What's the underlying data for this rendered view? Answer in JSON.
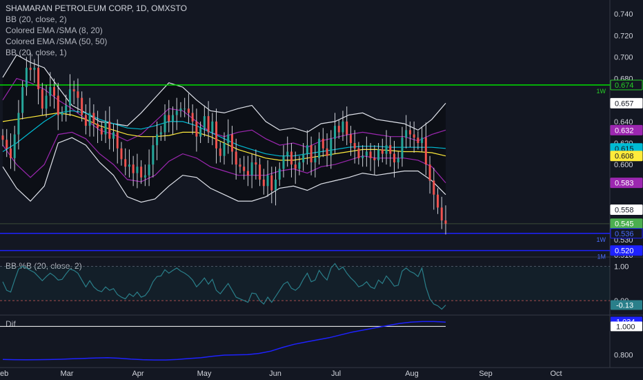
{
  "colors": {
    "background": "#131722",
    "up": "#26a69a",
    "down": "#ef5350",
    "bb_main": "#e0e3eb",
    "bb_inner": "#9c27b0",
    "ema_fast": "#00bcd4",
    "sma_slow": "#ffeb3b",
    "pct_line": "#2a7f8a",
    "dif_line": "#1e22ff",
    "green_line": "#00e000",
    "blue_line": "#1e22ff"
  },
  "legend": {
    "main_title": "SHAMARAN PETROLEUM CORP, 1D, OMXSTO",
    "bb_outer": "BB (20, close, 2)",
    "ema_sma_fast": "Colored EMA /SMA (8, 20)",
    "ema_sma_slow": "Colored EMA /SMA (50, 50)",
    "bb_inner": "BB (20, close, 1)",
    "pct_b": "BB %B (20, close, 2)",
    "dif": "Dif"
  },
  "chart_data": [
    {
      "type": "candlestick",
      "title": "SHAMARAN PETROLEUM CORP, 1D, OMXSTO",
      "x_ticks": [
        "Feb",
        "Mar",
        "Apr",
        "May",
        "Jun",
        "Jul",
        "Aug",
        "Sep",
        "Oct"
      ],
      "y_ticks": [
        0.74,
        0.72,
        0.7,
        0.68,
        0.657,
        0.64,
        0.62,
        0.6,
        0.558,
        0.53,
        0.516
      ],
      "ylim": [
        0.514,
        0.753
      ],
      "horizontal_levels": [
        {
          "value": 0.674,
          "label": "1W",
          "color": "#00e000"
        },
        {
          "value": 0.545,
          "label": "",
          "color": "#2e3a30"
        },
        {
          "value": 0.536,
          "label": "1W",
          "color": "#1e22ff"
        },
        {
          "value": 0.52,
          "label": "1M",
          "color": "#1e22ff"
        }
      ],
      "price_tags": [
        {
          "value": 0.674,
          "text": "0.674",
          "bg": "#131722",
          "fg": "#26d126",
          "border": "#26d126"
        },
        {
          "value": 0.657,
          "text": "0.657",
          "bg": "#ffffff",
          "fg": "#131722",
          "border": "#ffffff"
        },
        {
          "value": 0.632,
          "text": "0.632",
          "bg": "#9c27b0",
          "fg": "#ffffff",
          "border": "#9c27b0"
        },
        {
          "value": 0.615,
          "text": "0.615",
          "bg": "#00bcd4",
          "fg": "#131722",
          "border": "#00bcd4"
        },
        {
          "value": 0.608,
          "text": "0.608",
          "bg": "#ffeb3b",
          "fg": "#131722",
          "border": "#ffeb3b"
        },
        {
          "value": 0.583,
          "text": "0.583",
          "bg": "#9c27b0",
          "fg": "#ffffff",
          "border": "#9c27b0"
        },
        {
          "value": 0.558,
          "text": "0.558",
          "bg": "#ffffff",
          "fg": "#131722",
          "border": "#ffffff"
        },
        {
          "value": 0.545,
          "text": "0.545",
          "bg": "#4caf50",
          "fg": "#ffffff",
          "border": "#4caf50"
        },
        {
          "value": 0.536,
          "text": "0.536",
          "bg": "#131722",
          "fg": "#4a6cff",
          "border": "#1e22ff"
        },
        {
          "value": 0.52,
          "text": "0.520",
          "bg": "#1e22ff",
          "fg": "#ffffff",
          "border": "#1e22ff"
        }
      ],
      "series_close": [
        0.623,
        0.615,
        0.606,
        0.628,
        0.648,
        0.672,
        0.69,
        0.688,
        0.69,
        0.67,
        0.652,
        0.664,
        0.672,
        0.664,
        0.646,
        0.648,
        0.655,
        0.67,
        0.668,
        0.662,
        0.646,
        0.636,
        0.648,
        0.638,
        0.634,
        0.628,
        0.64,
        0.624,
        0.63,
        0.615,
        0.605,
        0.598,
        0.6,
        0.592,
        0.598,
        0.588,
        0.59,
        0.6,
        0.618,
        0.628,
        0.63,
        0.646,
        0.64,
        0.646,
        0.65,
        0.652,
        0.652,
        0.648,
        0.64,
        0.626,
        0.634,
        0.645,
        0.63,
        0.64,
        0.615,
        0.608,
        0.62,
        0.628,
        0.612,
        0.6,
        0.598,
        0.594,
        0.59,
        0.602,
        0.6,
        0.586,
        0.58,
        0.59,
        0.576,
        0.586,
        0.596,
        0.608,
        0.612,
        0.6,
        0.596,
        0.602,
        0.61,
        0.618,
        0.602,
        0.606,
        0.624,
        0.615,
        0.608,
        0.624,
        0.636,
        0.63,
        0.64,
        0.628,
        0.62,
        0.615,
        0.606,
        0.608,
        0.612,
        0.606,
        0.604,
        0.614,
        0.61,
        0.618,
        0.61,
        0.602,
        0.606,
        0.625,
        0.632,
        0.628,
        0.625,
        0.62,
        0.625,
        0.6,
        0.585,
        0.572,
        0.56,
        0.548,
        0.545
      ],
      "bb_outer_upper": [
        0.681,
        0.702,
        0.695,
        0.69,
        0.672,
        0.655,
        0.648,
        0.64,
        0.638,
        0.636,
        0.648,
        0.662,
        0.676,
        0.672,
        0.66,
        0.65,
        0.648,
        0.652,
        0.655,
        0.64,
        0.632,
        0.634,
        0.63,
        0.638,
        0.64,
        0.646,
        0.648,
        0.642,
        0.64,
        0.638,
        0.632,
        0.642,
        0.657
      ],
      "bb_outer_lower": [
        0.598,
        0.578,
        0.566,
        0.58,
        0.62,
        0.625,
        0.618,
        0.602,
        0.59,
        0.57,
        0.565,
        0.568,
        0.58,
        0.59,
        0.588,
        0.578,
        0.572,
        0.566,
        0.566,
        0.57,
        0.578,
        0.58,
        0.576,
        0.582,
        0.585,
        0.588,
        0.592,
        0.59,
        0.592,
        0.594,
        0.594,
        0.585,
        0.572
      ],
      "bb_inner_upper": [
        0.66,
        0.68,
        0.676,
        0.67,
        0.66,
        0.652,
        0.642,
        0.632,
        0.628,
        0.622,
        0.628,
        0.64,
        0.652,
        0.65,
        0.64,
        0.63,
        0.626,
        0.63,
        0.632,
        0.624,
        0.618,
        0.62,
        0.616,
        0.622,
        0.625,
        0.628,
        0.63,
        0.628,
        0.626,
        0.626,
        0.622,
        0.628,
        0.632
      ],
      "bb_inner_lower": [
        0.618,
        0.6,
        0.588,
        0.6,
        0.628,
        0.63,
        0.624,
        0.61,
        0.6,
        0.586,
        0.584,
        0.59,
        0.603,
        0.61,
        0.606,
        0.598,
        0.594,
        0.59,
        0.59,
        0.59,
        0.594,
        0.596,
        0.592,
        0.598,
        0.6,
        0.604,
        0.608,
        0.606,
        0.606,
        0.606,
        0.604,
        0.598,
        0.583
      ],
      "sma_slow": [
        0.64,
        0.642,
        0.644,
        0.646,
        0.648,
        0.646,
        0.642,
        0.636,
        0.632,
        0.628,
        0.626,
        0.626,
        0.627,
        0.63,
        0.63,
        0.626,
        0.62,
        0.614,
        0.61,
        0.606,
        0.604,
        0.604,
        0.606,
        0.608,
        0.61,
        0.612,
        0.614,
        0.614,
        0.613,
        0.612,
        0.612,
        0.611,
        0.608
      ],
      "ema_fast": [
        0.612,
        0.62,
        0.63,
        0.64,
        0.648,
        0.65,
        0.648,
        0.642,
        0.638,
        0.634,
        0.633,
        0.636,
        0.64,
        0.64,
        0.636,
        0.63,
        0.624,
        0.618,
        0.614,
        0.61,
        0.608,
        0.608,
        0.61,
        0.612,
        0.614,
        0.616,
        0.617,
        0.617,
        0.616,
        0.616,
        0.616,
        0.616,
        0.615
      ]
    },
    {
      "type": "line",
      "title": "BB %B (20, close, 2)",
      "y_ticks": [
        1.0,
        0.0
      ],
      "ylim": [
        -0.3,
        1.15
      ],
      "last_value_tag": {
        "text": "-0.13",
        "bg": "#2a7f8a",
        "fg": "#ffffff"
      },
      "values": [
        0.55,
        0.3,
        0.25,
        0.6,
        0.92,
        1.0,
        0.95,
        0.88,
        0.82,
        0.7,
        0.58,
        0.7,
        0.8,
        0.72,
        0.6,
        0.62,
        0.78,
        0.92,
        0.88,
        0.8,
        0.6,
        0.4,
        0.58,
        0.4,
        0.3,
        0.26,
        0.4,
        0.3,
        0.35,
        0.18,
        0.1,
        0.05,
        0.2,
        0.12,
        0.25,
        0.1,
        0.15,
        0.3,
        0.55,
        0.7,
        0.72,
        0.9,
        0.8,
        0.88,
        0.95,
        0.86,
        0.8,
        0.72,
        0.6,
        0.4,
        0.52,
        0.66,
        0.48,
        0.62,
        0.3,
        0.2,
        0.35,
        0.5,
        0.3,
        0.1,
        0.05,
        0.0,
        -0.05,
        0.22,
        0.2,
        0.0,
        -0.1,
        0.1,
        -0.05,
        0.12,
        0.3,
        0.48,
        0.55,
        0.36,
        0.3,
        0.4,
        0.62,
        0.8,
        0.55,
        0.6,
        0.88,
        0.72,
        0.6,
        0.95,
        1.08,
        0.9,
        0.98,
        0.8,
        0.66,
        0.55,
        0.4,
        0.45,
        0.55,
        0.4,
        0.35,
        0.6,
        0.5,
        0.72,
        0.58,
        0.42,
        0.45,
        0.86,
        0.95,
        0.85,
        0.8,
        0.7,
        0.95,
        0.4,
        0.05,
        -0.1,
        -0.15,
        -0.25,
        -0.13
      ]
    },
    {
      "type": "line",
      "title": "Dif",
      "y_ticks": [
        1.0,
        0.8
      ],
      "ylim": [
        0.73,
        1.06
      ],
      "value_tags": [
        {
          "text": "1.034",
          "bg": "#1e22ff",
          "fg": "#ffffff"
        },
        {
          "text": "1.000",
          "bg": "#ffffff",
          "fg": "#131722"
        }
      ],
      "reference_value": 1.0,
      "values": [
        0.768,
        0.766,
        0.765,
        0.766,
        0.767,
        0.769,
        0.772,
        0.775,
        0.778,
        0.78,
        0.776,
        0.77,
        0.766,
        0.764,
        0.764,
        0.768,
        0.774,
        0.78,
        0.79,
        0.798,
        0.8,
        0.802,
        0.81,
        0.826,
        0.852,
        0.874,
        0.89,
        0.905,
        0.92,
        0.94,
        0.96,
        0.975,
        0.99,
        1.005,
        1.02,
        1.03,
        1.034,
        1.034,
        1.03
      ]
    }
  ]
}
